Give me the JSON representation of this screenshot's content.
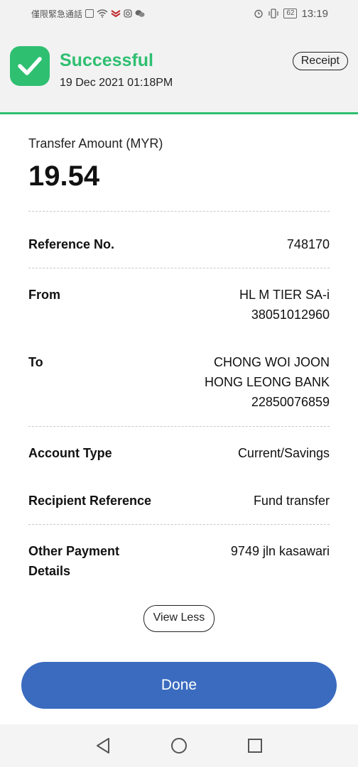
{
  "statusbar": {
    "carrier": "僅限緊急通話",
    "battery": "62",
    "time": "13:19"
  },
  "header": {
    "status": "Successful",
    "datetime": "19 Dec 2021 01:18PM",
    "receipt_label": "Receipt",
    "accent_color": "#2fbf71"
  },
  "transfer": {
    "amount_label": "Transfer Amount (MYR)",
    "amount": "19.54"
  },
  "details": {
    "reference": {
      "label": "Reference No.",
      "value": "748170"
    },
    "from": {
      "label": "From",
      "lines": [
        "HL M TIER SA-i",
        "38051012960"
      ]
    },
    "to": {
      "label": "To",
      "lines": [
        "CHONG WOI JOON",
        "HONG LEONG BANK",
        "22850076859"
      ]
    },
    "account_type": {
      "label": "Account Type",
      "value": "Current/Savings"
    },
    "recipient_reference": {
      "label": "Recipient Reference",
      "value": "Fund transfer"
    },
    "other_payment": {
      "label_lines": [
        "Other Payment",
        "Details"
      ],
      "value": "9749 jln kasawari"
    }
  },
  "actions": {
    "view_less_label": "View Less",
    "done_label": "Done",
    "done_color": "#3a6bbf"
  },
  "navbar": {
    "icons": [
      "back-icon",
      "home-icon",
      "recents-icon"
    ]
  }
}
